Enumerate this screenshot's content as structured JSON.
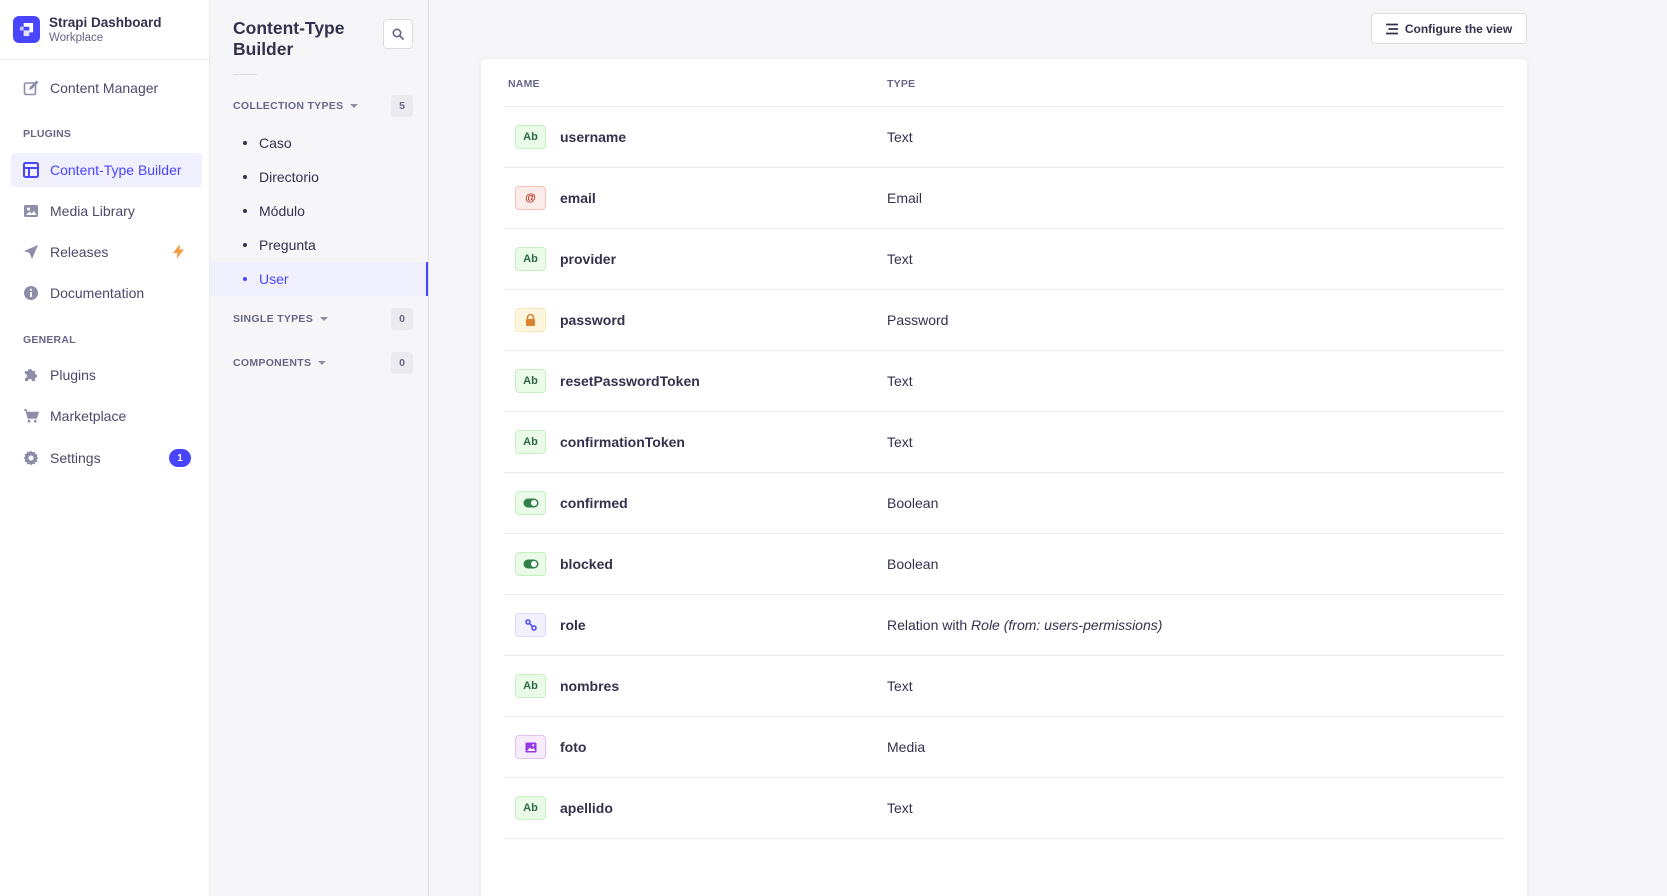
{
  "brand": {
    "title": "Strapi Dashboard",
    "subtitle": "Workplace"
  },
  "mainnav": {
    "content_manager": "Content Manager",
    "plugins_label": "PLUGINS",
    "ctb": "Content-Type Builder",
    "media": "Media Library",
    "releases": "Releases",
    "docs": "Documentation",
    "general_label": "GENERAL",
    "plugins": "Plugins",
    "marketplace": "Marketplace",
    "settings": "Settings",
    "settings_badge": "1"
  },
  "subnav": {
    "title": "Content-Type Builder",
    "collection": {
      "label": "COLLECTION TYPES",
      "count": "5",
      "items": [
        "Caso",
        "Directorio",
        "Módulo",
        "Pregunta",
        "User"
      ]
    },
    "single": {
      "label": "SINGLE TYPES",
      "count": "0"
    },
    "components": {
      "label": "COMPONENTS",
      "count": "0"
    }
  },
  "content": {
    "configure_label": "Configure the view",
    "headers": {
      "name": "NAME",
      "type": "TYPE"
    },
    "fields": [
      {
        "name": "username",
        "type": "Text",
        "icon": "text-icon",
        "badge": "Ab"
      },
      {
        "name": "email",
        "type": "Email",
        "icon": "email-icon",
        "badge": "@"
      },
      {
        "name": "provider",
        "type": "Text",
        "icon": "text-icon",
        "badge": "Ab"
      },
      {
        "name": "password",
        "type": "Password",
        "icon": "lock-icon",
        "badge": ""
      },
      {
        "name": "resetPasswordToken",
        "type": "Text",
        "icon": "text-icon",
        "badge": "Ab"
      },
      {
        "name": "confirmationToken",
        "type": "Text",
        "icon": "text-icon",
        "badge": "Ab"
      },
      {
        "name": "confirmed",
        "type": "Boolean",
        "icon": "toggle-icon",
        "badge": ""
      },
      {
        "name": "blocked",
        "type": "Boolean",
        "icon": "toggle-icon",
        "badge": ""
      },
      {
        "name": "role",
        "type_prefix": "Relation with ",
        "type_italic": "Role (from: users-permissions)",
        "icon": "relation-icon",
        "badge": ""
      },
      {
        "name": "nombres",
        "type": "Text",
        "icon": "text-icon",
        "badge": "Ab"
      },
      {
        "name": "foto",
        "type": "Media",
        "icon": "media-icon",
        "badge": ""
      },
      {
        "name": "apellido",
        "type": "Text",
        "icon": "text-icon",
        "badge": "Ab"
      }
    ]
  },
  "colors": {
    "accent": "#4945ff",
    "text": "#32324d",
    "muted": "#666687",
    "bolt": "#f29d41"
  }
}
